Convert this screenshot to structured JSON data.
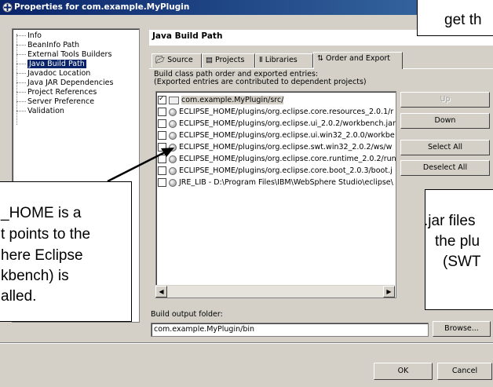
{
  "window": {
    "title": "Properties for com.example.MyPlugin"
  },
  "tree": {
    "items": [
      {
        "label": "Info",
        "selected": false
      },
      {
        "label": "BeanInfo Path",
        "selected": false
      },
      {
        "label": "External Tools Builders",
        "selected": false
      },
      {
        "label": "Java Build Path",
        "selected": true
      },
      {
        "label": "Javadoc Location",
        "selected": false
      },
      {
        "label": "Java JAR Dependencies",
        "selected": false
      },
      {
        "label": "Project References",
        "selected": false
      },
      {
        "label": "Server Preference",
        "selected": false
      },
      {
        "label": "Validation",
        "selected": false
      }
    ]
  },
  "page": {
    "title": "Java Build Path"
  },
  "tabs": [
    {
      "label": "Source",
      "icon": "source-folder-icon",
      "active": false
    },
    {
      "label": "Projects",
      "icon": "projects-icon",
      "active": false
    },
    {
      "label": "Libraries",
      "icon": "libraries-icon",
      "active": false
    },
    {
      "label": "Order and Export",
      "icon": "order-arrows-icon",
      "active": true
    }
  ],
  "order": {
    "desc_line1": "Build class path order and exported entries:",
    "desc_line2": "(Exported entries are contributed to dependent projects)",
    "entries": [
      {
        "label": "com.example.MyPlugin/src/",
        "checked": true,
        "kind": "folder"
      },
      {
        "label": "ECLIPSE_HOME/plugins/org.eclipse.core.resources_2.0.1/r",
        "checked": false,
        "kind": "jar"
      },
      {
        "label": "ECLIPSE_HOME/plugins/org.eclipse.ui_2.0.2/workbench.jar",
        "checked": false,
        "kind": "jar"
      },
      {
        "label": "ECLIPSE_HOME/plugins/org.eclipse.ui.win32_2.0.0/workbe",
        "checked": false,
        "kind": "jar"
      },
      {
        "label": "ECLIPSE_HOME/plugins/org.eclipse.swt.win32_2.0.2/ws/w",
        "checked": false,
        "kind": "jar"
      },
      {
        "label": "ECLIPSE_HOME/plugins/org.eclipse.core.runtime_2.0.2/run",
        "checked": false,
        "kind": "jar"
      },
      {
        "label": "ECLIPSE_HOME/plugins/org.eclipse.core.boot_2.0.3/boot.j",
        "checked": false,
        "kind": "jar"
      },
      {
        "label": "JRE_LIB - D:\\Program Files\\IBM\\WebSphere Studio\\eclipse\\",
        "checked": false,
        "kind": "jar"
      }
    ],
    "buttons": {
      "up": "Up",
      "down": "Down",
      "select_all": "Select All",
      "deselect_all": "Deselect All"
    }
  },
  "output": {
    "label": "Build output folder:",
    "value": "com.example.MyPlugin/bin",
    "browse": "Browse..."
  },
  "dialog": {
    "ok": "OK",
    "cancel": "Cancel"
  },
  "callouts": {
    "top_right": [
      "get th"
    ],
    "left": [
      "_HOME is a",
      "t points to the",
      "here Eclipse",
      "kbench) is",
      "alled."
    ],
    "right": [
      ".jar files",
      "the plu",
      "(SWT"
    ]
  }
}
